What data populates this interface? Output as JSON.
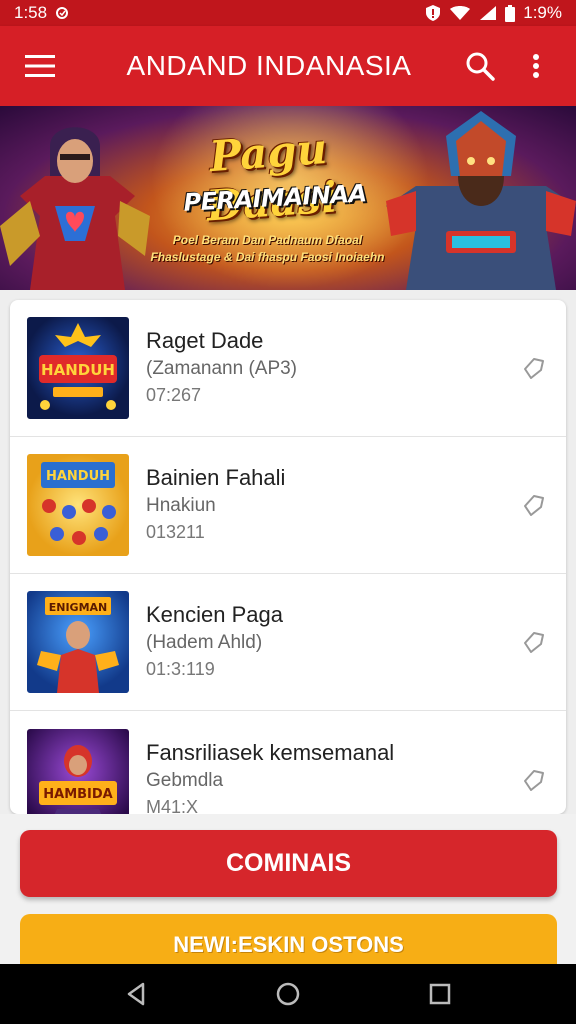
{
  "status_bar": {
    "time": "1:58",
    "battery_text": "1:9%",
    "icons": [
      "notification-icon",
      "alert-icon",
      "wifi-icon",
      "signal-icon",
      "battery-icon"
    ]
  },
  "app_bar": {
    "title": "ANDAND INDANASIA",
    "icons": [
      "menu-icon",
      "search-icon",
      "more-vert-icon"
    ]
  },
  "banner": {
    "title": "Pagu Daasi",
    "subtitle": "PERAIMAINAA",
    "tagline_line1": "Poel Beram Dan Padnaum Dfaoal",
    "tagline_line2": "Fhaslustage & Dai fhaspu Faosi Inoiaehn"
  },
  "list": {
    "items": [
      {
        "title": "Raget Dade",
        "subtitle": "(Zamanann (AP3)",
        "meta": "07:267",
        "thumb_text": "HANDUH"
      },
      {
        "title": "Bainien Fahali",
        "subtitle": "Hnakiun",
        "meta": "013211",
        "thumb_text": "HANDUH"
      },
      {
        "title": "Kencien Paga",
        "subtitle": "(Hadem Ahld)",
        "meta": "01:3:119",
        "thumb_text": "ENIGMAN"
      },
      {
        "title": "Fansriliasek kemsemanal",
        "subtitle": "Gebmdla",
        "meta": "M41:X",
        "thumb_text": "HAMBIDA"
      }
    ]
  },
  "buttons": {
    "primary": "COMINAIS",
    "secondary": "NEWI:ESKIN OSTONS"
  },
  "colors": {
    "app_bar": "#d61f26",
    "status_bar": "#c0161c",
    "primary_button": "#d6262b",
    "secondary_button": "#f7ae15"
  },
  "nav_bar": {
    "icons": [
      "back-icon",
      "home-icon",
      "recents-icon"
    ]
  }
}
